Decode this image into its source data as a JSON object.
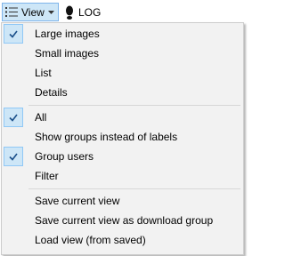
{
  "toolbar": {
    "view_label": "View",
    "log_label": "LOG"
  },
  "menu": {
    "group1": [
      {
        "label": "Large images",
        "checked": true
      },
      {
        "label": "Small images",
        "checked": false
      },
      {
        "label": "List",
        "checked": false
      },
      {
        "label": "Details",
        "checked": false
      }
    ],
    "group2": [
      {
        "label": "All",
        "checked": true
      },
      {
        "label": "Show groups instead of labels",
        "checked": false
      },
      {
        "label": "Group users",
        "checked": true
      },
      {
        "label": "Filter",
        "checked": false
      }
    ],
    "group3": [
      {
        "label": "Save current view",
        "checked": false
      },
      {
        "label": "Save current view as download group",
        "checked": false
      },
      {
        "label": "Load view (from saved)",
        "checked": false
      }
    ]
  },
  "icons": {
    "view": "list-icon",
    "dropdown": "chevron-down-icon",
    "log": "footprint-icon",
    "check": "checkmark-icon"
  },
  "colors": {
    "highlight_bg": "#cde6f7",
    "highlight_border": "#7eb4ea",
    "menu_bg": "#f2f2f2",
    "check_color": "#1a4f8a"
  }
}
